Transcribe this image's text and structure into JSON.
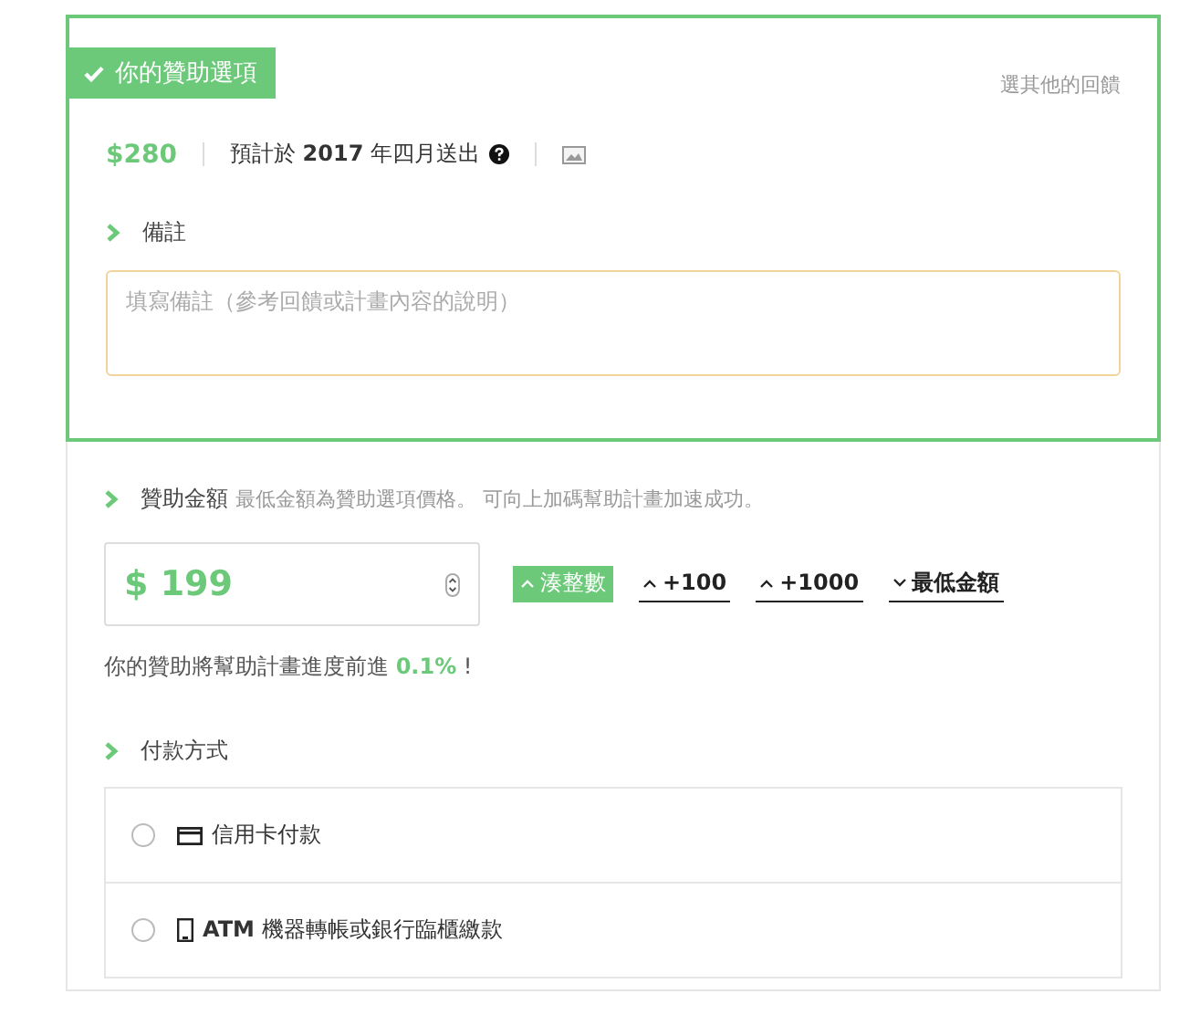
{
  "reward": {
    "badge": "你的贊助選項",
    "change_link": "選其他的回饋",
    "price": "$280",
    "delivery": "預計於 **2017** 年四月送出",
    "note_label": "備註",
    "note_placeholder": "填寫備註（參考回饋或計畫內容的說明）"
  },
  "amount": {
    "label": "贊助金額",
    "hint": "最低金額為贊助選項價格。 可向上加碼幫助計畫加速成功。",
    "value": "$ 199",
    "buttons": [
      {
        "label": "湊整數",
        "kind": "up",
        "selected": true
      },
      {
        "label": "+100",
        "kind": "up",
        "selected": false
      },
      {
        "label": "+1000",
        "kind": "up",
        "selected": false
      },
      {
        "label": "最低金額",
        "kind": "down",
        "selected": false
      }
    ],
    "progress": "你的贊助將幫助計畫進度前進 **0.1%** !"
  },
  "payment": {
    "label": "付款方式",
    "methods": [
      {
        "label": "信用卡付款",
        "kind": "card",
        "selected": false
      },
      {
        "label": "**ATM** 機器轉帳或銀行臨櫃繳款",
        "kind": "device",
        "selected": false
      }
    ]
  }
}
